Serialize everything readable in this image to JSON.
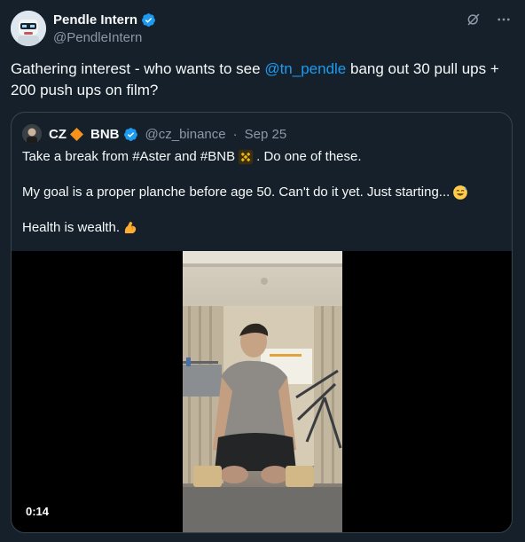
{
  "tweet": {
    "author_name": "Pendle Intern",
    "author_handle": "@PendleIntern",
    "text_before": "Gathering interest - who wants to see ",
    "mention": "@tn_pendle",
    "text_after": " bang out 30 pull ups + 200 push ups on film?"
  },
  "quote": {
    "author_name": "CZ",
    "author_name_2": "BNB",
    "handle": "@cz_binance",
    "separator": "·",
    "date": "Sep 25",
    "line1_before": "Take a break from #Aster and #BNB",
    "line1_after": ". Do one of these.",
    "line2": "My goal is a proper planche before age 50. Can't do it yet. Just starting...",
    "line3": "Health is wealth."
  },
  "video": {
    "duration": "0:14"
  },
  "colors": {
    "background": "#15202b",
    "accent": "#1d9bf0",
    "muted": "#8b98a5",
    "border": "#38444d",
    "bnb_yellow": "#f0b90b",
    "diamond_orange": "#f7931a"
  },
  "icons": {
    "verified": "verified-badge-icon",
    "grok": "grok-icon",
    "more": "more-icon",
    "bnb": "bnb-logo-icon",
    "sweat": "sweat-smile-emoji",
    "flex": "flexed-biceps-emoji"
  }
}
